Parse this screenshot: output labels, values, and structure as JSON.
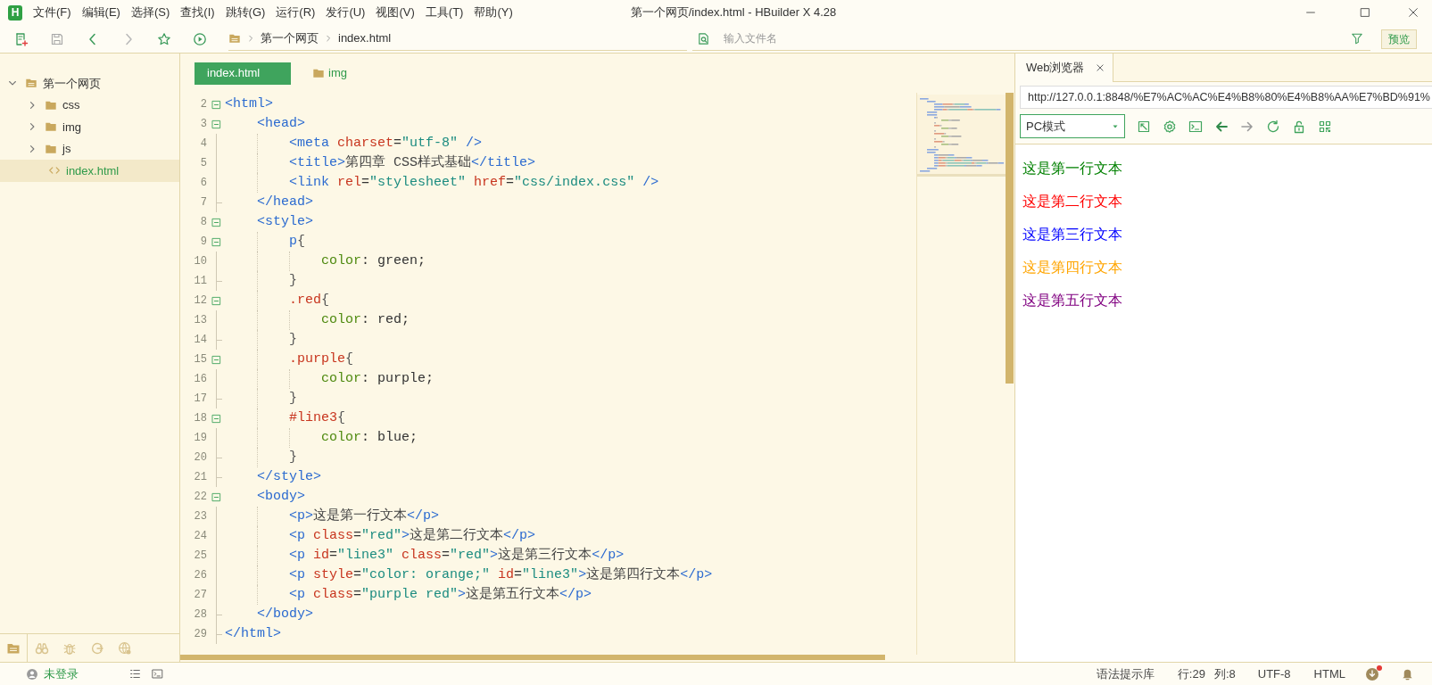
{
  "window": {
    "logo_text": "H",
    "title": "第一个网页/index.html - HBuilder X 4.28"
  },
  "menu": [
    "文件(F)",
    "编辑(E)",
    "选择(S)",
    "查找(I)",
    "跳转(G)",
    "运行(R)",
    "发行(U)",
    "视图(V)",
    "工具(T)",
    "帮助(Y)"
  ],
  "toolbar": [
    {
      "kind": "new",
      "disabled": false
    },
    {
      "kind": "save",
      "disabled": true
    },
    {
      "kind": "back",
      "disabled": false
    },
    {
      "kind": "forward",
      "disabled": true
    },
    {
      "kind": "star",
      "disabled": false
    },
    {
      "kind": "run",
      "disabled": false
    }
  ],
  "breadcrumb": [
    "第一个网页",
    "index.html"
  ],
  "file_search": {
    "placeholder": "输入文件名"
  },
  "preview_button": "预览",
  "tree": [
    {
      "label": "第一个网页",
      "kind": "project",
      "expanded": true,
      "selected": false,
      "children": [
        {
          "label": "css",
          "kind": "folder",
          "expanded": false,
          "selected": false
        },
        {
          "label": "img",
          "kind": "folder",
          "expanded": false,
          "selected": false
        },
        {
          "label": "js",
          "kind": "folder",
          "expanded": false,
          "selected": false
        },
        {
          "label": "index.html",
          "kind": "file",
          "selected": true
        }
      ]
    }
  ],
  "sidebar_tabs": [
    {
      "kind": "files",
      "selected": true
    },
    {
      "kind": "binoculars",
      "selected": false
    },
    {
      "kind": "bug",
      "selected": false
    },
    {
      "kind": "plugin",
      "selected": false
    },
    {
      "kind": "globe",
      "selected": false
    }
  ],
  "editor_tabs": [
    {
      "label": "index.html",
      "kind": "file",
      "selected": true
    },
    {
      "label": "img",
      "kind": "folder",
      "selected": false
    }
  ],
  "code": [
    {
      "number": "2",
      "kind": "open",
      "tokens": [
        {
          "kind": "tag",
          "text": "<html>"
        }
      ],
      "children": [
        {
          "number": "3",
          "kind": "open",
          "tokens": [
            {
              "kind": "tag",
              "text": "<head>"
            }
          ],
          "children": [
            {
              "number": "4",
              "kind": "line",
              "tokens": [
                {
                  "kind": "tag",
                  "text": "<meta "
                },
                {
                  "kind": "attr",
                  "text": "charset"
                },
                {
                  "kind": "eq",
                  "text": "="
                },
                {
                  "kind": "str",
                  "text": "\"utf-8\""
                },
                {
                  "kind": "tag",
                  "text": " />"
                }
              ]
            },
            {
              "number": "5",
              "kind": "line",
              "tokens": [
                {
                  "kind": "tag",
                  "text": "<title>"
                },
                {
                  "kind": "text",
                  "text": "第四章 CSS样式基础"
                },
                {
                  "kind": "tag",
                  "text": "</title>"
                }
              ]
            },
            {
              "number": "6",
              "kind": "line",
              "tokens": [
                {
                  "kind": "tag",
                  "text": "<link "
                },
                {
                  "kind": "attr",
                  "text": "rel"
                },
                {
                  "kind": "eq",
                  "text": "="
                },
                {
                  "kind": "str",
                  "text": "\"stylesheet\" "
                },
                {
                  "kind": "attr",
                  "text": "href"
                },
                {
                  "kind": "eq",
                  "text": "="
                },
                {
                  "kind": "str",
                  "text": "\"css/index.css\""
                },
                {
                  "kind": "tag",
                  "text": " />"
                }
              ]
            }
          ]
        },
        {
          "number": "7",
          "kind": "close",
          "tokens": [
            {
              "kind": "tag",
              "text": "</head>"
            }
          ]
        },
        {
          "number": "8",
          "kind": "open",
          "tokens": [
            {
              "kind": "tag",
              "text": "<style>"
            }
          ],
          "children": [
            {
              "number": "9",
              "kind": "open",
              "tokens": [
                {
                  "kind": "sel",
                  "text": "p"
                },
                {
                  "kind": "brace",
                  "text": "{"
                }
              ],
              "children": [
                {
                  "number": "10",
                  "kind": "line",
                  "tokens": [
                    {
                      "kind": "prop",
                      "text": "color"
                    },
                    {
                      "kind": "eq",
                      "text": ": "
                    },
                    {
                      "kind": "val",
                      "text": "green;"
                    }
                  ]
                }
              ]
            },
            {
              "number": "11",
              "kind": "close",
              "tokens": [
                {
                  "kind": "brace",
                  "text": "}"
                }
              ]
            },
            {
              "number": "12",
              "kind": "open",
              "tokens": [
                {
                  "kind": "selred",
                  "text": ".red"
                },
                {
                  "kind": "brace",
                  "text": "{"
                }
              ],
              "children": [
                {
                  "number": "13",
                  "kind": "line",
                  "tokens": [
                    {
                      "kind": "prop",
                      "text": "color"
                    },
                    {
                      "kind": "eq",
                      "text": ": "
                    },
                    {
                      "kind": "val",
                      "text": "red;"
                    }
                  ]
                }
              ]
            },
            {
              "number": "14",
              "kind": "close",
              "tokens": [
                {
                  "kind": "brace",
                  "text": "}"
                }
              ]
            },
            {
              "number": "15",
              "kind": "open",
              "tokens": [
                {
                  "kind": "selred",
                  "text": ".purple"
                },
                {
                  "kind": "brace",
                  "text": "{"
                }
              ],
              "children": [
                {
                  "number": "16",
                  "kind": "line",
                  "tokens": [
                    {
                      "kind": "prop",
                      "text": "color"
                    },
                    {
                      "kind": "eq",
                      "text": ": "
                    },
                    {
                      "kind": "val",
                      "text": "purple;"
                    }
                  ]
                }
              ]
            },
            {
              "number": "17",
              "kind": "close",
              "tokens": [
                {
                  "kind": "brace",
                  "text": "}"
                }
              ]
            },
            {
              "number": "18",
              "kind": "open",
              "tokens": [
                {
                  "kind": "selred",
                  "text": "#line3"
                },
                {
                  "kind": "brace",
                  "text": "{"
                }
              ],
              "children": [
                {
                  "number": "19",
                  "kind": "line",
                  "tokens": [
                    {
                      "kind": "prop",
                      "text": "color"
                    },
                    {
                      "kind": "eq",
                      "text": ": "
                    },
                    {
                      "kind": "val",
                      "text": "blue;"
                    }
                  ]
                }
              ]
            },
            {
              "number": "20",
              "kind": "close",
              "tokens": [
                {
                  "kind": "brace",
                  "text": "}"
                }
              ]
            }
          ]
        },
        {
          "number": "21",
          "kind": "close",
          "tokens": [
            {
              "kind": "tag",
              "text": "</style>"
            }
          ]
        },
        {
          "number": "22",
          "kind": "open",
          "tokens": [
            {
              "kind": "tag",
              "text": "<body>"
            }
          ],
          "children": [
            {
              "number": "23",
              "kind": "line",
              "tokens": [
                {
                  "kind": "tag",
                  "text": "<p>"
                },
                {
                  "kind": "text",
                  "text": "这是第一行文本"
                },
                {
                  "kind": "tag",
                  "text": "</p>"
                }
              ]
            },
            {
              "number": "24",
              "kind": "line",
              "tokens": [
                {
                  "kind": "tag",
                  "text": "<p "
                },
                {
                  "kind": "attr",
                  "text": "class"
                },
                {
                  "kind": "eq",
                  "text": "="
                },
                {
                  "kind": "str",
                  "text": "\"red\""
                },
                {
                  "kind": "tag",
                  "text": ">"
                },
                {
                  "kind": "text",
                  "text": "这是第二行文本"
                },
                {
                  "kind": "tag",
                  "text": "</p>"
                }
              ]
            },
            {
              "number": "25",
              "kind": "line",
              "tokens": [
                {
                  "kind": "tag",
                  "text": "<p "
                },
                {
                  "kind": "attr",
                  "text": "id"
                },
                {
                  "kind": "eq",
                  "text": "="
                },
                {
                  "kind": "str",
                  "text": "\"line3\" "
                },
                {
                  "kind": "attr",
                  "text": "class"
                },
                {
                  "kind": "eq",
                  "text": "="
                },
                {
                  "kind": "str",
                  "text": "\"red\""
                },
                {
                  "kind": "tag",
                  "text": ">"
                },
                {
                  "kind": "text",
                  "text": "这是第三行文本"
                },
                {
                  "kind": "tag",
                  "text": "</p>"
                }
              ]
            },
            {
              "number": "26",
              "kind": "line",
              "tokens": [
                {
                  "kind": "tag",
                  "text": "<p "
                },
                {
                  "kind": "attr",
                  "text": "style"
                },
                {
                  "kind": "eq",
                  "text": "="
                },
                {
                  "kind": "str",
                  "text": "\"color: orange;\" "
                },
                {
                  "kind": "attr",
                  "text": "id"
                },
                {
                  "kind": "eq",
                  "text": "="
                },
                {
                  "kind": "str",
                  "text": "\"line3\""
                },
                {
                  "kind": "tag",
                  "text": ">"
                },
                {
                  "kind": "text",
                  "text": "这是第四行文本"
                },
                {
                  "kind": "tag",
                  "text": "</p>"
                }
              ]
            },
            {
              "number": "27",
              "kind": "line",
              "tokens": [
                {
                  "kind": "tag",
                  "text": "<p "
                },
                {
                  "kind": "attr",
                  "text": "class"
                },
                {
                  "kind": "eq",
                  "text": "="
                },
                {
                  "kind": "str",
                  "text": "\"purple red\""
                },
                {
                  "kind": "tag",
                  "text": ">"
                },
                {
                  "kind": "text",
                  "text": "这是第五行文本"
                },
                {
                  "kind": "tag",
                  "text": "</p>"
                }
              ]
            }
          ]
        },
        {
          "number": "28",
          "kind": "close",
          "tokens": [
            {
              "kind": "tag",
              "text": "</body>"
            }
          ]
        }
      ]
    },
    {
      "number": "29",
      "kind": "close",
      "tokens": [
        {
          "kind": "tag",
          "text": "</html>"
        }
      ]
    }
  ],
  "browser": {
    "tab": "Web浏览器",
    "url": "http://127.0.0.1:8848/%E7%AC%AC%E4%B8%80%E4%B8%AA%E7%BD%91%",
    "mode": "PC模式",
    "tools": [
      {
        "kind": "external",
        "disabled": false
      },
      {
        "kind": "gear",
        "disabled": false
      },
      {
        "kind": "terminal",
        "disabled": false
      },
      {
        "kind": "back",
        "disabled": false
      },
      {
        "kind": "forward",
        "disabled": true
      },
      {
        "kind": "reload",
        "disabled": false
      },
      {
        "kind": "lock",
        "disabled": false
      },
      {
        "kind": "qr",
        "disabled": false
      }
    ],
    "paragraphs": [
      {
        "text": "这是第一行文本",
        "color": "#008000"
      },
      {
        "text": "这是第二行文本",
        "color": "#ff0000"
      },
      {
        "text": "这是第三行文本",
        "color": "#0000ff"
      },
      {
        "text": "这是第四行文本",
        "color": "#ffa500"
      },
      {
        "text": "这是第五行文本",
        "color": "#800080"
      }
    ]
  },
  "status_bar": {
    "login": "未登录",
    "syntax_library": "语法提示库",
    "line": "行:29",
    "column": "列:8",
    "encoding": "UTF-8",
    "language": "HTML",
    "update_dot": true
  }
}
